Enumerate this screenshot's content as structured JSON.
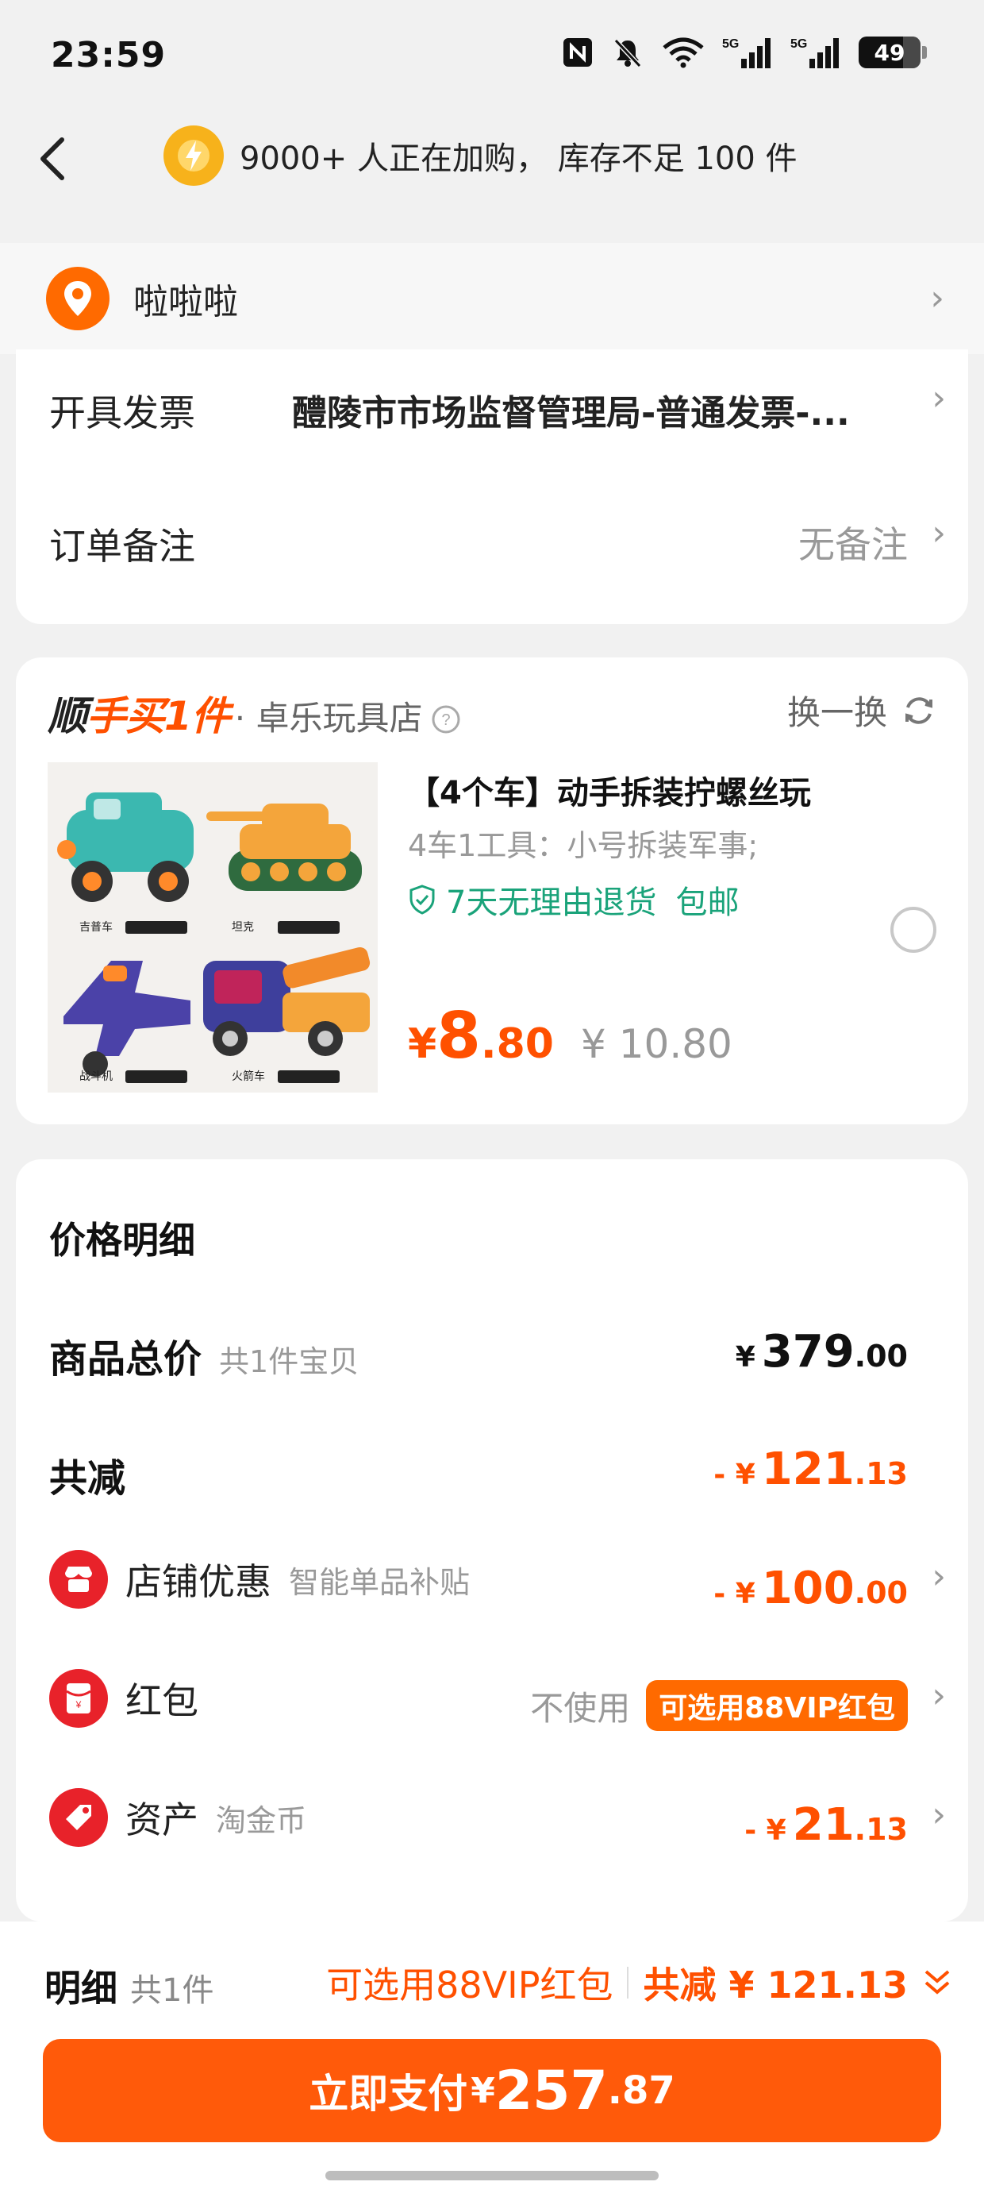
{
  "status": {
    "time": "23:59",
    "battery": "49",
    "signal1_label": "5G",
    "signal2_label": "5G"
  },
  "nav": {
    "notice": "9000+ 人正在加购， 库存不足 100 件"
  },
  "address": {
    "name": "啦啦啦"
  },
  "order": {
    "invoice_label": "开具发票",
    "invoice_value": "醴陵市市场监督管理局-普通发票-...",
    "remark_label": "订单备注",
    "remark_value": "无备注"
  },
  "addon": {
    "brand_part1": "顺",
    "brand_part2": "手买1件",
    "shop_name": "· 卓乐玩具店",
    "swap_label": "换一换",
    "product_title": "【4个车】动手拆装拧螺丝玩",
    "product_spec": "4车1工具：小号拆装军事;",
    "return_policy": "7天无理由退货",
    "shipping": "包邮",
    "price_symbol": "¥",
    "price_int": "8",
    "price_dec": ".80",
    "price_old": "¥ 10.80",
    "image_labels": [
      "吉普车",
      "坦克",
      "战斗机",
      "火箭车"
    ]
  },
  "price_detail": {
    "title": "价格明细",
    "total_label": "商品总价",
    "total_sub": "共1件宝贝",
    "total_symbol": "¥",
    "total_int": "379",
    "total_dec": ".00",
    "reduce_label": "共减",
    "reduce_prefix": "- ¥",
    "reduce_int": "121",
    "reduce_dec": ".13",
    "shop_discount_label": "店铺优惠",
    "shop_discount_sub": "智能单品补贴",
    "shop_discount_prefix": "- ¥",
    "shop_discount_int": "100",
    "shop_discount_dec": ".00",
    "redpacket_label": "红包",
    "redpacket_value": "不使用",
    "redpacket_badge": "可选用88VIP红包",
    "asset_label": "资产",
    "asset_sub": "淘金币",
    "asset_prefix": "- ¥",
    "asset_int": "21",
    "asset_dec": ".13"
  },
  "bottom": {
    "detail_label": "明细",
    "detail_count": "共1件",
    "vip_hint": "可选用88VIP红包",
    "reduce_summary": "共减 ¥ 121.13",
    "pay_label": "立即支付",
    "pay_symbol": "¥",
    "pay_int": "257",
    "pay_dec": ".87"
  },
  "colors": {
    "accent": "#ff5000",
    "button": "#ff5a0a",
    "green": "#1aa37a",
    "gold": "#f7b21b",
    "red_icon": "#e8222a"
  }
}
